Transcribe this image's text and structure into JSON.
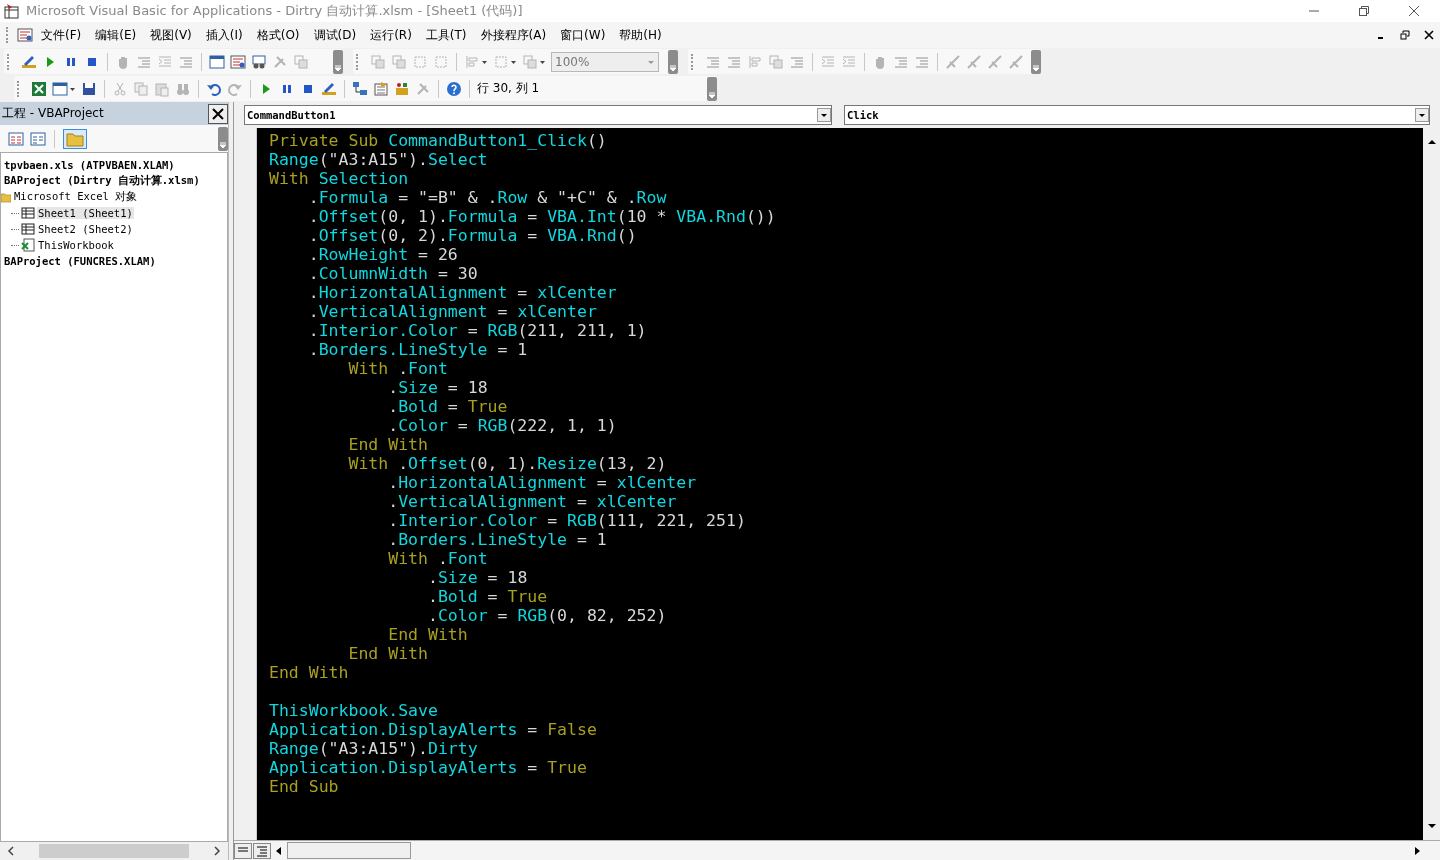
{
  "window": {
    "title": "Microsoft Visual Basic for Applications - Dirtry 自动计算.xlsm - [Sheet1 (代码)]"
  },
  "menu": [
    "文件(F)",
    "编辑(E)",
    "视图(V)",
    "插入(I)",
    "格式(O)",
    "调试(D)",
    "运行(R)",
    "工具(T)",
    "外接程序(A)",
    "窗口(W)",
    "帮助(H)"
  ],
  "toolbar": {
    "zoom": "100%",
    "position": "行 30, 列 1"
  },
  "project_pane": {
    "title": "工程 - VBAProject",
    "tree": [
      {
        "label": "tpvbaen.xls (ATPVBAEN.XLAM)",
        "kind": "project",
        "selected": false
      },
      {
        "label": "BAProject (Dirtry 自动计算.xlsm)",
        "kind": "project",
        "selected": false,
        "children": [
          {
            "label": "Microsoft Excel 对象",
            "kind": "folder",
            "selected": false,
            "children": [
              {
                "label": "Sheet1 (Sheet1)",
                "kind": "sheet",
                "selected": true
              },
              {
                "label": "Sheet2 (Sheet2)",
                "kind": "sheet",
                "selected": false
              },
              {
                "label": "ThisWorkbook",
                "kind": "workbook",
                "selected": false
              }
            ]
          }
        ]
      },
      {
        "label": "BAProject (FUNCRES.XLAM)",
        "kind": "project",
        "selected": false
      }
    ]
  },
  "code_window": {
    "object": "CommandButton1",
    "procedure": "Click",
    "lines": [
      {
        "kind": "code",
        "tokens": [
          {
            "kind": "keyword",
            "t": "Private Sub "
          },
          {
            "kind": "identifier",
            "t": "CommandButton1_Click"
          },
          {
            "kind": "text",
            "t": "()"
          }
        ]
      },
      {
        "kind": "code",
        "tokens": [
          {
            "kind": "identifier",
            "t": "Range"
          },
          {
            "kind": "text",
            "t": "(\"A3:A15\")."
          },
          {
            "kind": "identifier",
            "t": "Select"
          }
        ]
      },
      {
        "kind": "code",
        "tokens": [
          {
            "kind": "keyword",
            "t": "With "
          },
          {
            "kind": "identifier",
            "t": "Selection"
          }
        ]
      },
      {
        "kind": "code",
        "tokens": [
          {
            "kind": "text",
            "t": "    ."
          },
          {
            "kind": "identifier",
            "t": "Formula"
          },
          {
            "kind": "text",
            "t": " = \"=B\" & ."
          },
          {
            "kind": "identifier",
            "t": "Row"
          },
          {
            "kind": "text",
            "t": " & \"+C\" & ."
          },
          {
            "kind": "identifier",
            "t": "Row"
          }
        ]
      },
      {
        "kind": "code",
        "tokens": [
          {
            "kind": "text",
            "t": "    ."
          },
          {
            "kind": "identifier",
            "t": "Offset"
          },
          {
            "kind": "text",
            "t": "(0, 1)."
          },
          {
            "kind": "identifier",
            "t": "Formula"
          },
          {
            "kind": "text",
            "t": " = "
          },
          {
            "kind": "identifier",
            "t": "VBA.Int"
          },
          {
            "kind": "text",
            "t": "(10 * "
          },
          {
            "kind": "identifier",
            "t": "VBA.Rnd"
          },
          {
            "kind": "text",
            "t": "())"
          }
        ]
      },
      {
        "kind": "code",
        "tokens": [
          {
            "kind": "text",
            "t": "    ."
          },
          {
            "kind": "identifier",
            "t": "Offset"
          },
          {
            "kind": "text",
            "t": "(0, 2)."
          },
          {
            "kind": "identifier",
            "t": "Formula"
          },
          {
            "kind": "text",
            "t": " = "
          },
          {
            "kind": "identifier",
            "t": "VBA.Rnd"
          },
          {
            "kind": "text",
            "t": "()"
          }
        ]
      },
      {
        "kind": "code",
        "tokens": [
          {
            "kind": "text",
            "t": "    ."
          },
          {
            "kind": "identifier",
            "t": "RowHeight"
          },
          {
            "kind": "text",
            "t": " = 26"
          }
        ]
      },
      {
        "kind": "code",
        "tokens": [
          {
            "kind": "text",
            "t": "    ."
          },
          {
            "kind": "identifier",
            "t": "ColumnWidth"
          },
          {
            "kind": "text",
            "t": " = 30"
          }
        ]
      },
      {
        "kind": "code",
        "tokens": [
          {
            "kind": "text",
            "t": "    ."
          },
          {
            "kind": "identifier",
            "t": "HorizontalAlignment"
          },
          {
            "kind": "text",
            "t": " = "
          },
          {
            "kind": "identifier",
            "t": "xlCenter"
          }
        ]
      },
      {
        "kind": "code",
        "tokens": [
          {
            "kind": "text",
            "t": "    ."
          },
          {
            "kind": "identifier",
            "t": "VerticalAlignment"
          },
          {
            "kind": "text",
            "t": " = "
          },
          {
            "kind": "identifier",
            "t": "xlCenter"
          }
        ]
      },
      {
        "kind": "code",
        "tokens": [
          {
            "kind": "text",
            "t": "    ."
          },
          {
            "kind": "identifier",
            "t": "Interior.Color"
          },
          {
            "kind": "text",
            "t": " = "
          },
          {
            "kind": "identifier",
            "t": "RGB"
          },
          {
            "kind": "text",
            "t": "(211, 211, 1)"
          }
        ]
      },
      {
        "kind": "code",
        "tokens": [
          {
            "kind": "text",
            "t": "    ."
          },
          {
            "kind": "identifier",
            "t": "Borders.LineStyle"
          },
          {
            "kind": "text",
            "t": " = 1"
          }
        ]
      },
      {
        "kind": "code",
        "tokens": [
          {
            "kind": "keyword",
            "t": "        With "
          },
          {
            "kind": "text",
            "t": "."
          },
          {
            "kind": "identifier",
            "t": "Font"
          }
        ]
      },
      {
        "kind": "code",
        "tokens": [
          {
            "kind": "text",
            "t": "            ."
          },
          {
            "kind": "identifier",
            "t": "Size"
          },
          {
            "kind": "text",
            "t": " = 18"
          }
        ]
      },
      {
        "kind": "code",
        "tokens": [
          {
            "kind": "text",
            "t": "            ."
          },
          {
            "kind": "identifier",
            "t": "Bold"
          },
          {
            "kind": "text",
            "t": " = "
          },
          {
            "kind": "keyword",
            "t": "True"
          }
        ]
      },
      {
        "kind": "code",
        "tokens": [
          {
            "kind": "text",
            "t": "            ."
          },
          {
            "kind": "identifier",
            "t": "Color"
          },
          {
            "kind": "text",
            "t": " = "
          },
          {
            "kind": "identifier",
            "t": "RGB"
          },
          {
            "kind": "text",
            "t": "(222, 1, 1)"
          }
        ]
      },
      {
        "kind": "code",
        "tokens": [
          {
            "kind": "keyword",
            "t": "        End With"
          }
        ]
      },
      {
        "kind": "code",
        "tokens": [
          {
            "kind": "keyword",
            "t": "        With "
          },
          {
            "kind": "text",
            "t": "."
          },
          {
            "kind": "identifier",
            "t": "Offset"
          },
          {
            "kind": "text",
            "t": "(0, 1)."
          },
          {
            "kind": "identifier",
            "t": "Resize"
          },
          {
            "kind": "text",
            "t": "(13, 2)"
          }
        ]
      },
      {
        "kind": "code",
        "tokens": [
          {
            "kind": "text",
            "t": "            ."
          },
          {
            "kind": "identifier",
            "t": "HorizontalAlignment"
          },
          {
            "kind": "text",
            "t": " = "
          },
          {
            "kind": "identifier",
            "t": "xlCenter"
          }
        ]
      },
      {
        "kind": "code",
        "tokens": [
          {
            "kind": "text",
            "t": "            ."
          },
          {
            "kind": "identifier",
            "t": "VerticalAlignment"
          },
          {
            "kind": "text",
            "t": " = "
          },
          {
            "kind": "identifier",
            "t": "xlCenter"
          }
        ]
      },
      {
        "kind": "code",
        "tokens": [
          {
            "kind": "text",
            "t": "            ."
          },
          {
            "kind": "identifier",
            "t": "Interior.Color"
          },
          {
            "kind": "text",
            "t": " = "
          },
          {
            "kind": "identifier",
            "t": "RGB"
          },
          {
            "kind": "text",
            "t": "(111, 221, 251)"
          }
        ]
      },
      {
        "kind": "code",
        "tokens": [
          {
            "kind": "text",
            "t": "            ."
          },
          {
            "kind": "identifier",
            "t": "Borders.LineStyle"
          },
          {
            "kind": "text",
            "t": " = 1"
          }
        ]
      },
      {
        "kind": "code",
        "tokens": [
          {
            "kind": "keyword",
            "t": "            With "
          },
          {
            "kind": "text",
            "t": "."
          },
          {
            "kind": "identifier",
            "t": "Font"
          }
        ]
      },
      {
        "kind": "code",
        "tokens": [
          {
            "kind": "text",
            "t": "                ."
          },
          {
            "kind": "identifier",
            "t": "Size"
          },
          {
            "kind": "text",
            "t": " = 18"
          }
        ]
      },
      {
        "kind": "code",
        "tokens": [
          {
            "kind": "text",
            "t": "                ."
          },
          {
            "kind": "identifier",
            "t": "Bold"
          },
          {
            "kind": "text",
            "t": " = "
          },
          {
            "kind": "keyword",
            "t": "True"
          }
        ]
      },
      {
        "kind": "code",
        "tokens": [
          {
            "kind": "text",
            "t": "                ."
          },
          {
            "kind": "identifier",
            "t": "Color"
          },
          {
            "kind": "text",
            "t": " = "
          },
          {
            "kind": "identifier",
            "t": "RGB"
          },
          {
            "kind": "text",
            "t": "(0, 82, 252)"
          }
        ]
      },
      {
        "kind": "code",
        "tokens": [
          {
            "kind": "keyword",
            "t": "            End With"
          }
        ]
      },
      {
        "kind": "code",
        "tokens": [
          {
            "kind": "keyword",
            "t": "        End With"
          }
        ]
      },
      {
        "kind": "code",
        "tokens": [
          {
            "kind": "keyword",
            "t": "End With"
          }
        ]
      },
      {
        "kind": "blank"
      },
      {
        "kind": "code",
        "tokens": [
          {
            "kind": "identifier",
            "t": "ThisWorkbook.Save"
          }
        ]
      },
      {
        "kind": "code",
        "tokens": [
          {
            "kind": "identifier",
            "t": "Application.DisplayAlerts"
          },
          {
            "kind": "text",
            "t": " = "
          },
          {
            "kind": "keyword",
            "t": "False"
          }
        ]
      },
      {
        "kind": "code",
        "tokens": [
          {
            "kind": "identifier",
            "t": "Range"
          },
          {
            "kind": "text",
            "t": "(\"A3:A15\")."
          },
          {
            "kind": "identifier",
            "t": "Dirty"
          }
        ]
      },
      {
        "kind": "code",
        "tokens": [
          {
            "kind": "identifier",
            "t": "Application.DisplayAlerts"
          },
          {
            "kind": "text",
            "t": " = "
          },
          {
            "kind": "keyword",
            "t": "True"
          }
        ]
      },
      {
        "kind": "code",
        "tokens": [
          {
            "kind": "keyword",
            "t": "End Sub"
          }
        ]
      }
    ]
  }
}
